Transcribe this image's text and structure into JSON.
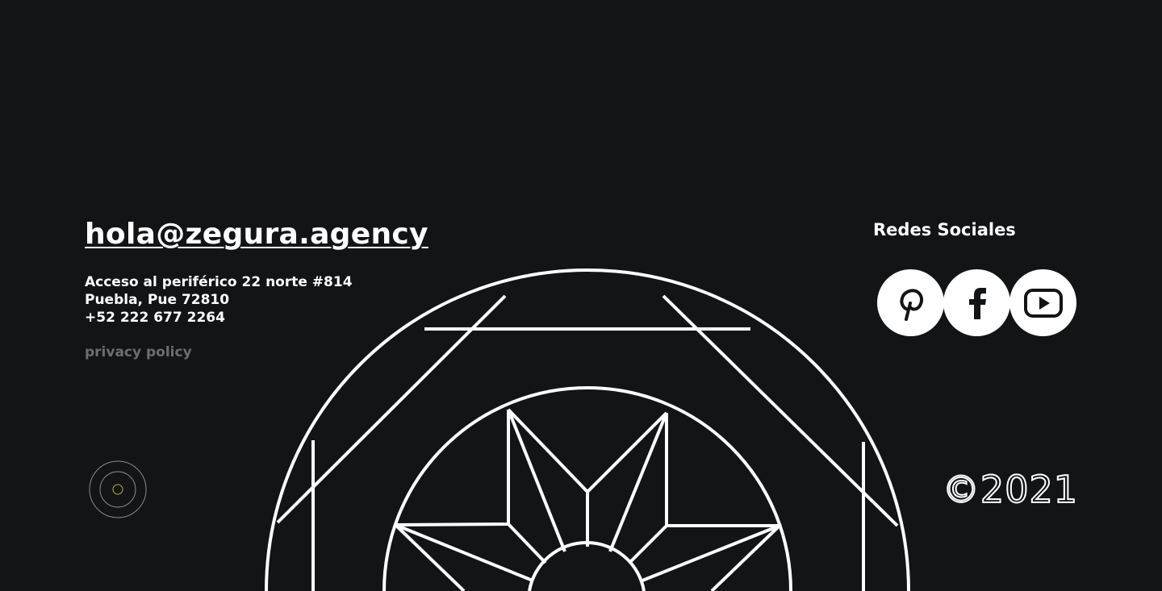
{
  "contact": {
    "email": "hola@zegura.agency",
    "address_line1": "Acceso al periférico 22 norte #814",
    "address_line2": "Puebla, Pue 72810",
    "phone": "+52 222 677 2264",
    "privacy": "privacy policy"
  },
  "social": {
    "title": "Redes Sociales",
    "icons": [
      "pinterest-icon",
      "facebook-icon",
      "youtube-icon"
    ]
  },
  "footer": {
    "copyright": "©2021"
  },
  "colors": {
    "background": "#131416",
    "text": "#ffffff",
    "muted": "#6d6e70",
    "indicator_dot": "#b8b23a"
  }
}
